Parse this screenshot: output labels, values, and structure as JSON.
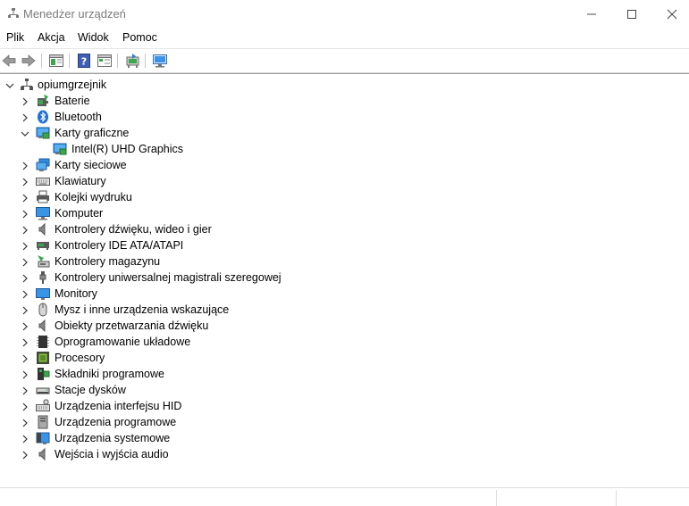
{
  "window": {
    "title": "Menedżer urządzeń"
  },
  "menu": [
    "Plik",
    "Akcja",
    "Widok",
    "Pomoc"
  ],
  "tree": {
    "root": "opiumgrzejnik",
    "categories": [
      {
        "label": "Baterie",
        "icon": "battery-icon",
        "expanded": false
      },
      {
        "label": "Bluetooth",
        "icon": "bluetooth-icon",
        "expanded": false
      },
      {
        "label": "Karty graficzne",
        "icon": "display-adapter-icon",
        "expanded": true,
        "children": [
          {
            "label": "Intel(R) UHD Graphics",
            "icon": "display-adapter-icon"
          }
        ]
      },
      {
        "label": "Karty sieciowe",
        "icon": "network-adapter-icon",
        "expanded": false
      },
      {
        "label": "Klawiatury",
        "icon": "keyboard-icon",
        "expanded": false
      },
      {
        "label": "Kolejki wydruku",
        "icon": "printer-icon",
        "expanded": false
      },
      {
        "label": "Komputer",
        "icon": "computer-icon",
        "expanded": false
      },
      {
        "label": "Kontrolery dźwięku, wideo i gier",
        "icon": "speaker-icon",
        "expanded": false
      },
      {
        "label": "Kontrolery IDE ATA/ATAPI",
        "icon": "ide-controller-icon",
        "expanded": false
      },
      {
        "label": "Kontrolery magazynu",
        "icon": "storage-controller-icon",
        "expanded": false
      },
      {
        "label": "Kontrolery uniwersalnej magistrali szeregowej",
        "icon": "usb-icon",
        "expanded": false
      },
      {
        "label": "Monitory",
        "icon": "monitor-icon",
        "expanded": false
      },
      {
        "label": "Mysz i inne urządzenia wskazujące",
        "icon": "mouse-icon",
        "expanded": false
      },
      {
        "label": "Obiekty przetwarzania dźwięku",
        "icon": "speaker-icon",
        "expanded": false
      },
      {
        "label": "Oprogramowanie układowe",
        "icon": "firmware-chip-icon",
        "expanded": false
      },
      {
        "label": "Procesory",
        "icon": "processor-icon",
        "expanded": false
      },
      {
        "label": "Składniki programowe",
        "icon": "software-component-icon",
        "expanded": false
      },
      {
        "label": "Stacje dysków",
        "icon": "disk-drive-icon",
        "expanded": false
      },
      {
        "label": "Urządzenia interfejsu HID",
        "icon": "hid-icon",
        "expanded": false
      },
      {
        "label": "Urządzenia programowe",
        "icon": "software-device-icon",
        "expanded": false
      },
      {
        "label": "Urządzenia systemowe",
        "icon": "system-device-icon",
        "expanded": false
      },
      {
        "label": "Wejścia i wyjścia audio",
        "icon": "speaker-icon",
        "expanded": false
      }
    ]
  }
}
